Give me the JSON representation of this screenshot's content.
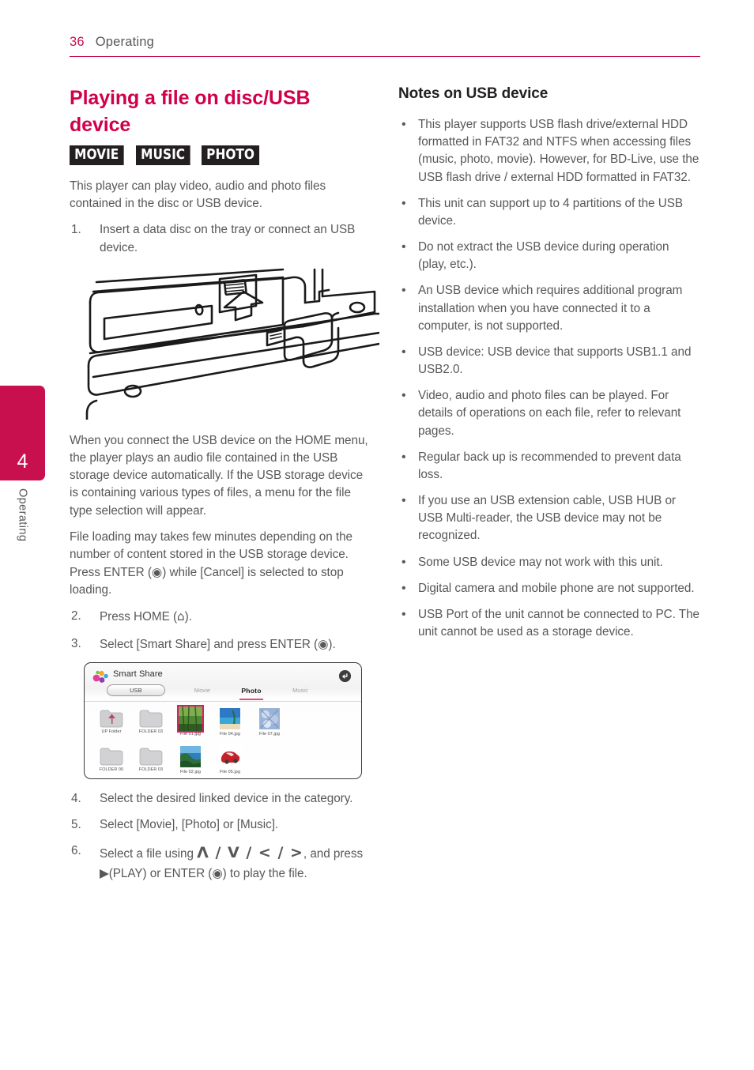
{
  "header": {
    "page_number": "36",
    "section": "Operating"
  },
  "side_tab": {
    "chapter": "4",
    "label": "Operating"
  },
  "left": {
    "title": "Playing a file on disc/USB device",
    "badges": [
      "MOVIE",
      "MUSIC",
      "PHOTO"
    ],
    "intro": "This player can play video, audio and photo files contained in the disc or USB device.",
    "step1_num": "1.",
    "step1": "Insert a data disc on the tray or connect an USB device.",
    "para_home": "When you connect the USB device on the HOME menu, the player plays an audio file contained in the USB storage device automatically. If the USB storage device is containing various types of files, a menu for the file type selection will appear.",
    "para_loading_a": "File loading may takes few minutes depending on the number of content stored in the USB storage device. Press ENTER (",
    "para_loading_b": ") while [Cancel] is selected to stop loading.",
    "step2_num": "2.",
    "step2_a": "Press HOME (",
    "step2_b": ").",
    "step3_num": "3.",
    "step3_a": "Select [Smart Share] and press ENTER (",
    "step3_b": ").",
    "step4_num": "4.",
    "step4": "Select the desired linked device in the category.",
    "step5_num": "5.",
    "step5": "Select [Movie], [Photo] or [Music].",
    "step6_num": "6.",
    "step6_a": "Select a file using ",
    "step6_arrows": "Λ / V / < / >",
    "step6_b": ", and press ",
    "step6_play": "▶(PLAY) or ENTER (",
    "step6_c": ") to play the file."
  },
  "smart_share": {
    "title": "Smart Share",
    "device_label": "USB",
    "tabs": [
      {
        "label": "Movie",
        "active": false
      },
      {
        "label": "Photo",
        "active": true
      },
      {
        "label": "Music",
        "active": false
      }
    ],
    "items": [
      {
        "label": "UP Folder",
        "type": "up-folder",
        "selected": false
      },
      {
        "label": "FOLDER 03",
        "type": "folder",
        "selected": false
      },
      {
        "label": "File 01.jpg",
        "type": "photo-forest",
        "selected": true
      },
      {
        "label": "File 04.jpg",
        "type": "photo-beach",
        "selected": false
      },
      {
        "label": "File 07.jpg",
        "type": "photo-flower",
        "selected": false
      },
      {
        "label": "FOLDER 00",
        "type": "folder",
        "selected": false
      },
      {
        "label": "FOLDER 03",
        "type": "folder",
        "selected": false
      },
      {
        "label": "File 02.jpg",
        "type": "photo-coast",
        "selected": false
      },
      {
        "label": "File 05.jpg",
        "type": "photo-car",
        "selected": false
      }
    ]
  },
  "right": {
    "title": "Notes on USB device",
    "notes": [
      "This player supports USB flash drive/external HDD formatted in FAT32 and NTFS when accessing files (music, photo, movie). However, for BD-Live, use the USB flash drive / external HDD formatted in FAT32.",
      "This unit can support up to 4 partitions of the USB device.",
      "Do not extract the USB device during operation (play, etc.).",
      "An USB device which requires additional program installation when you have connected it to a computer, is not supported.",
      "USB device: USB device that supports USB1.1 and USB2.0.",
      "Video, audio and photo files can be played. For details of operations on each file, refer to relevant pages.",
      "Regular back up is recommended to prevent data loss.",
      "If you use an USB extension cable, USB HUB or USB Multi-reader, the USB device may not be recognized.",
      "Some USB device may not work with this unit.",
      "Digital camera and mobile phone are not supported.",
      "USB Port of the unit cannot be connected to PC. The unit cannot be used as a storage device."
    ]
  },
  "colors": {
    "accent": "#c8104f",
    "title": "#d1004b",
    "body": "#58585b",
    "selection": "#e8146e"
  }
}
